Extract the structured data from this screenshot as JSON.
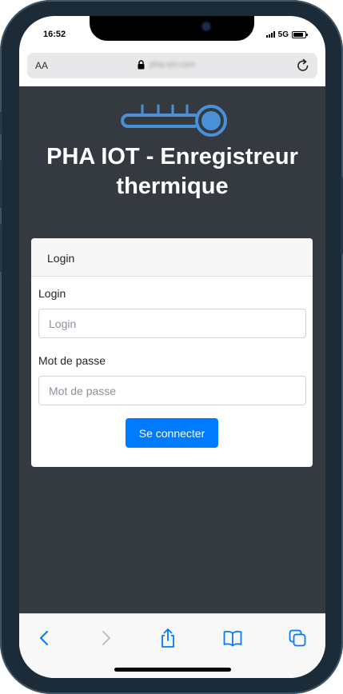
{
  "status_bar": {
    "time": "16:52",
    "network": "5G",
    "battery_level": 0.85,
    "signal_bars": 4
  },
  "browser": {
    "text_size_label": "AA",
    "url": "pha-iot.com",
    "icons": {
      "lock": "lock-icon",
      "reload": "reload-icon",
      "back": "chevron-left-icon",
      "forward": "chevron-right-icon",
      "share": "share-icon",
      "bookmarks": "book-icon",
      "tabs": "tabs-icon"
    },
    "toolbar_enabled": {
      "back": true,
      "forward": false
    }
  },
  "page": {
    "logo_icon": "thermometer-icon",
    "title": "PHA IOT - Enregistreur thermique",
    "card_header": "Login",
    "login_label": "Login",
    "login_placeholder": "Login",
    "login_value": "",
    "password_label": "Mot de passe",
    "password_placeholder": "Mot de passe",
    "password_value": "",
    "submit_label": "Se connecter"
  },
  "colors": {
    "page_background": "#343a40",
    "primary": "#007bff",
    "logo": "#4a90d9",
    "ios_blue": "#007aff",
    "frame": "#1c2b38"
  }
}
